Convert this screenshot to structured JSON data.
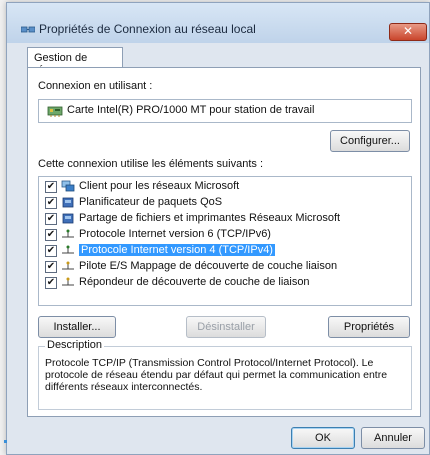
{
  "window": {
    "title": "Propriétés de Connexion au réseau local",
    "close_label": "✕"
  },
  "tabs": [
    {
      "label": "Gestion de réseau"
    }
  ],
  "connect_using": {
    "label": "Connexion en utilisant :",
    "adapter": "Carte Intel(R) PRO/1000 MT pour station de travail",
    "configure_button": "Configurer..."
  },
  "items_section": {
    "label": "Cette connexion utilise les éléments suivants :",
    "items": [
      {
        "label": "Client pour les réseaux Microsoft",
        "checked": true,
        "icon": "network-client-icon"
      },
      {
        "label": "Planificateur de paquets QoS",
        "checked": true,
        "icon": "service-icon"
      },
      {
        "label": "Partage de fichiers et imprimantes Réseaux Microsoft",
        "checked": true,
        "icon": "service-icon"
      },
      {
        "label": "Protocole Internet version 6 (TCP/IPv6)",
        "checked": true,
        "icon": "protocol-icon"
      },
      {
        "label": "Protocole Internet version 4 (TCP/IPv4)",
        "checked": true,
        "icon": "protocol-icon",
        "selected": true
      },
      {
        "label": "Pilote E/S Mappage de découverte de couche liaison",
        "checked": true,
        "icon": "protocol-icon"
      },
      {
        "label": "Répondeur de découverte de couche de liaison",
        "checked": true,
        "icon": "protocol-icon"
      }
    ]
  },
  "buttons": {
    "install": "Installer...",
    "uninstall": "Désinstaller",
    "properties": "Propriétés",
    "ok": "OK",
    "cancel": "Annuler"
  },
  "description": {
    "title": "Description",
    "text": "Protocole TCP/IP (Transmission Control Protocol/Internet Protocol). Le protocole de réseau étendu par défaut qui permet la communication entre différents réseaux interconnectés."
  },
  "colors": {
    "selection": "#3399ff",
    "titlebar": "#c9dbef",
    "close": "#c9452c"
  }
}
